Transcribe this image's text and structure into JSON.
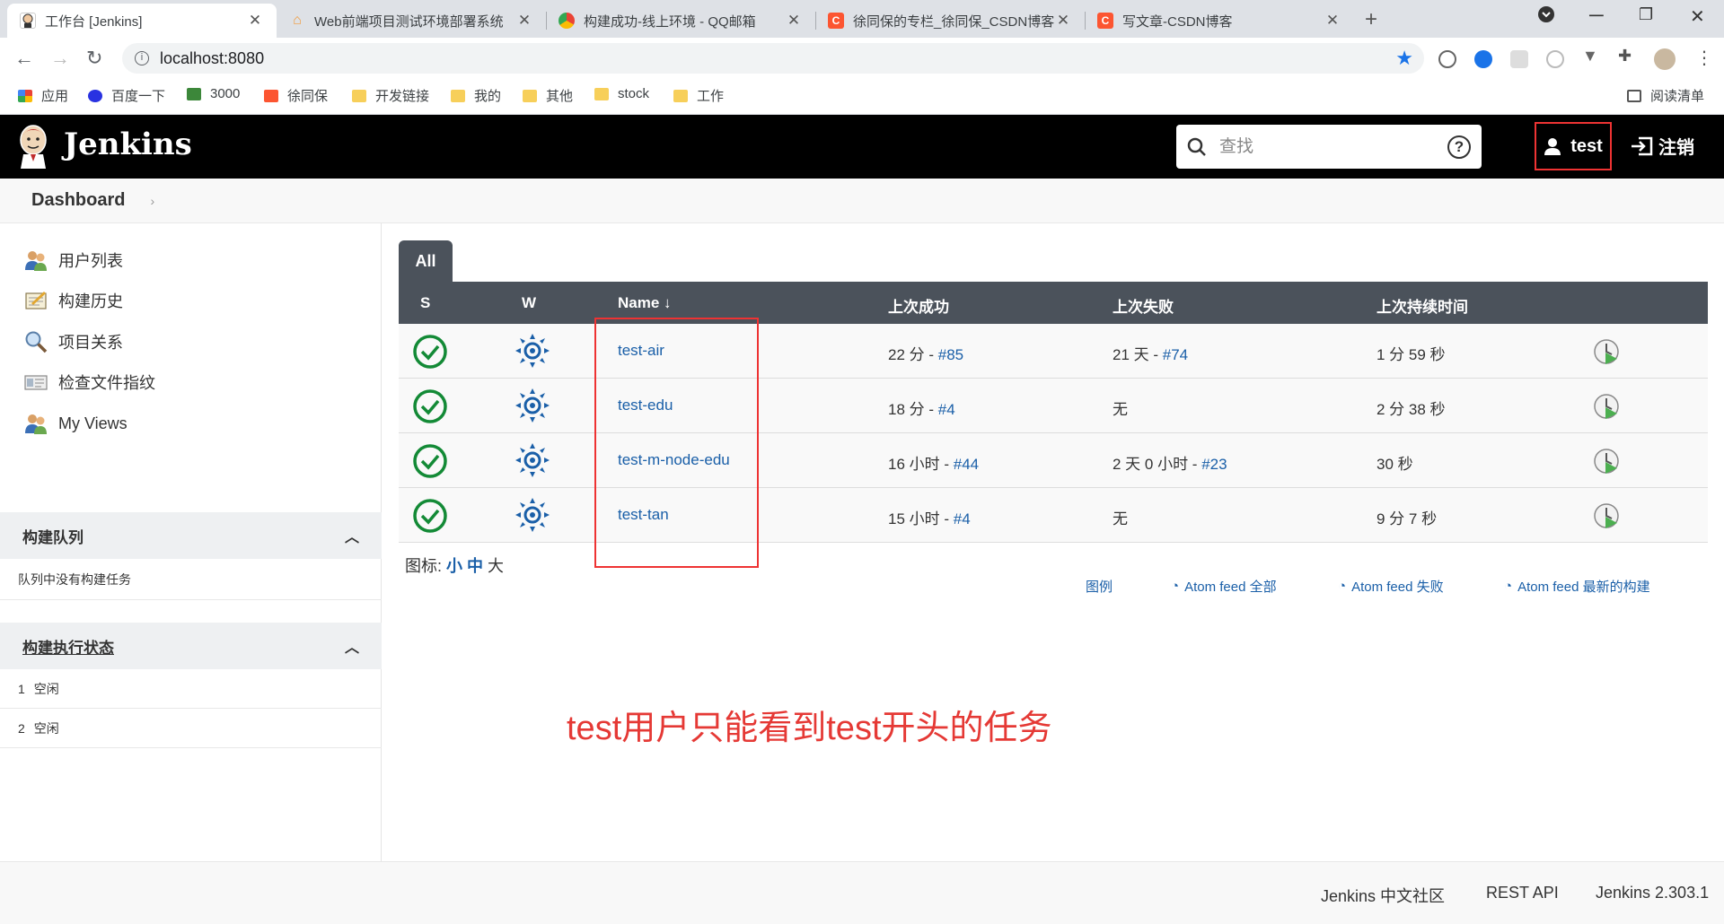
{
  "browser": {
    "tabs": [
      {
        "title": "工作台 [Jenkins]",
        "active": true
      },
      {
        "title": "Web前端项目测试环境部署系统",
        "active": false
      },
      {
        "title": "构建成功-线上环境 - QQ邮箱",
        "active": false
      },
      {
        "title": "徐同保的专栏_徐同保_CSDN博客",
        "active": false
      },
      {
        "title": "写文章-CSDN博客",
        "active": false
      }
    ],
    "tab_close": "✕",
    "new_tab": "+",
    "url": "localhost:8080",
    "bookmarks": [
      {
        "label": "应用",
        "icon": "apps-grid-icon"
      },
      {
        "label": "百度一下",
        "icon": "baidu-icon"
      },
      {
        "label": "3000",
        "icon": "node-icon"
      },
      {
        "label": "徐同保",
        "icon": "csdn-icon"
      },
      {
        "label": "开发链接",
        "icon": "folder-icon"
      },
      {
        "label": "我的",
        "icon": "folder-icon"
      },
      {
        "label": "其他",
        "icon": "folder-icon"
      },
      {
        "label": "stock",
        "icon": "folder-icon"
      },
      {
        "label": "工作",
        "icon": "folder-icon"
      }
    ],
    "reading_list": "阅读清单"
  },
  "header": {
    "brand": "Jenkins",
    "search_placeholder": "查找",
    "help": "?",
    "user": "test",
    "logout": "注销"
  },
  "breadcrumb": {
    "item": "Dashboard",
    "chevron": "›"
  },
  "side": {
    "tasks": [
      {
        "label": "用户列表",
        "icon": "users-icon"
      },
      {
        "label": "构建历史",
        "icon": "notepad-icon"
      },
      {
        "label": "项目关系",
        "icon": "magnifier-icon"
      },
      {
        "label": "检查文件指纹",
        "icon": "fingerprint-card-icon"
      },
      {
        "label": "My Views",
        "icon": "users-icon"
      }
    ],
    "queue": {
      "title": "构建队列",
      "empty": "队列中没有构建任务"
    },
    "executors": {
      "title": "构建执行状态",
      "items": [
        {
          "num": "1",
          "state": "空闲"
        },
        {
          "num": "2",
          "state": "空闲"
        }
      ]
    }
  },
  "view_tab": "All",
  "table": {
    "headers": {
      "s": "S",
      "w": "W",
      "name": "Name ↓",
      "last_success": "上次成功",
      "last_failure": "上次失败",
      "last_duration": "上次持续时间"
    },
    "rows": [
      {
        "name": "test-air",
        "success_time": "22 分 - ",
        "success_build": "#85",
        "failure_time": "21 天 - ",
        "failure_build": "#74",
        "duration": "1 分 59 秒"
      },
      {
        "name": "test-edu",
        "success_time": "18 分 - ",
        "success_build": "#4",
        "failure_time": "无",
        "failure_build": "",
        "duration": "2 分 38 秒"
      },
      {
        "name": "test-m-node-edu",
        "success_time": "16 小时 - ",
        "success_build": "#44",
        "failure_time": "2 天 0 小时 - ",
        "failure_build": "#23",
        "duration": "30 秒"
      },
      {
        "name": "test-tan",
        "success_time": "15 小时 - ",
        "success_build": "#4",
        "failure_time": "无",
        "failure_build": "",
        "duration": "9 分 7 秒"
      }
    ]
  },
  "icon_size": {
    "label": "图标: ",
    "small": "小",
    "medium": "中",
    "large": "大"
  },
  "feeds": {
    "legend": "图例",
    "all": "Atom feed 全部",
    "failed": "Atom feed 失败",
    "latest": "Atom feed 最新的构建"
  },
  "annotation": "test用户只能看到test开头的任务",
  "footer": {
    "community": "Jenkins 中文社区",
    "rest_api": "REST API",
    "version": "Jenkins 2.303.1"
  },
  "colors": {
    "header_bg": "#000000",
    "table_head": "#4b525b",
    "link": "#1a5fa8",
    "success": "#138a36",
    "annotation": "#e53935"
  }
}
